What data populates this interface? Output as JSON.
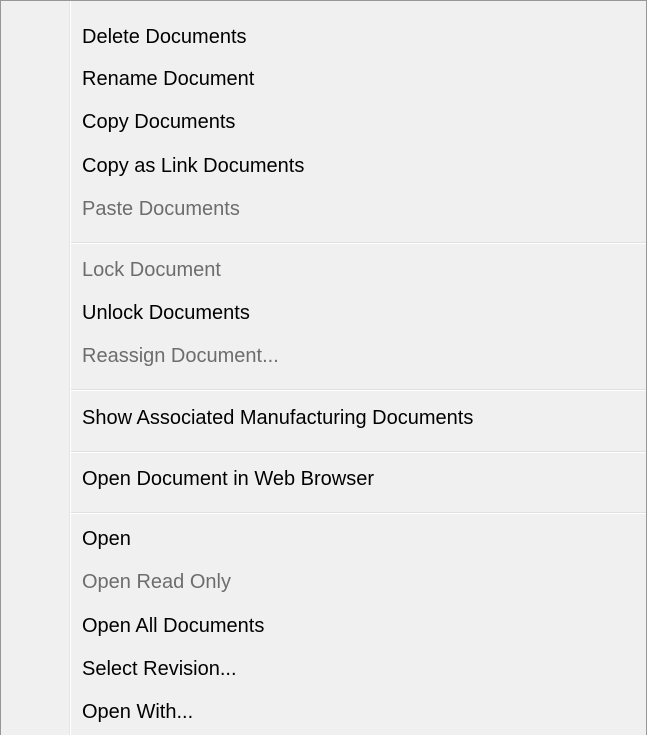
{
  "menu": {
    "group1": {
      "delete_documents": "Delete Documents",
      "rename_document": "Rename Document",
      "copy_documents": "Copy Documents",
      "copy_as_link_documents": "Copy as Link Documents",
      "paste_documents": "Paste Documents"
    },
    "group2": {
      "lock_document": "Lock Document",
      "unlock_documents": "Unlock Documents",
      "reassign_document": "Reassign Document..."
    },
    "group3": {
      "show_associated_manufacturing_documents": "Show Associated Manufacturing Documents"
    },
    "group4": {
      "open_document_in_web_browser": "Open Document in Web Browser"
    },
    "group5": {
      "open": "Open",
      "open_read_only": "Open Read Only",
      "open_all_documents": "Open All Documents",
      "select_revision": "Select Revision...",
      "open_with": "Open With..."
    },
    "disabled_color": "#6d6d6d",
    "enabled_color": "#000000",
    "background": "#f0f0f0"
  }
}
